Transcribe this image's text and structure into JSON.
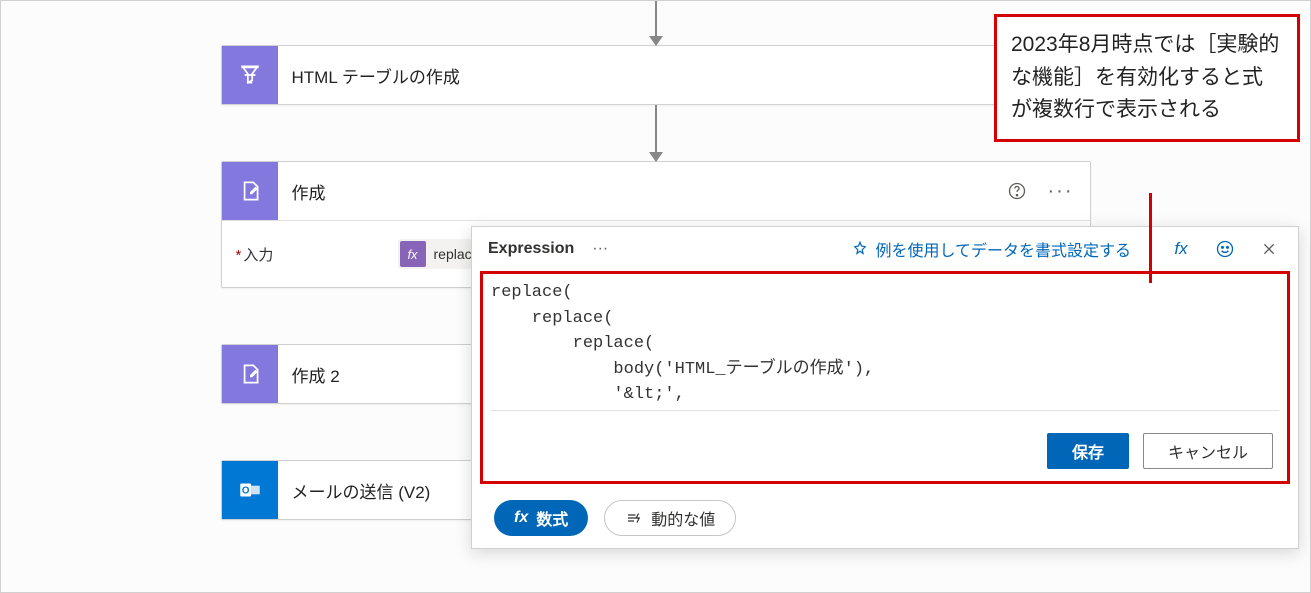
{
  "actions": {
    "html_table": {
      "title": "HTML テーブルの作成"
    },
    "compose": {
      "title": "作成",
      "input_label": "入力",
      "token_text": "replace(...)"
    },
    "compose2": {
      "title": "作成 2"
    },
    "send_mail": {
      "title": "メールの送信 (V2)"
    }
  },
  "callout": {
    "text": "2023年8月時点では［実験的な機能］を有効化すると式が複数行で表示される"
  },
  "popup": {
    "title": "Expression",
    "format_link": "例を使用してデータを書式設定する",
    "code": "replace(\n    replace(\n        replace(\n            body('HTML_テーブルの作成'),\n            '&lt;',",
    "save": "保存",
    "cancel": "キャンセル",
    "tab_formula": "数式",
    "tab_dynamic": "動的な値"
  }
}
